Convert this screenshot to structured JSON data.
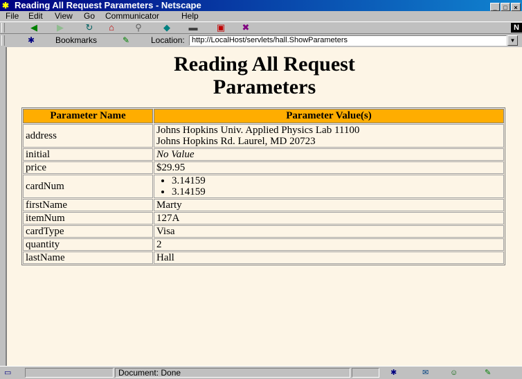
{
  "window": {
    "title": "Reading All Request Parameters - Netscape",
    "controls": [
      "_",
      "□",
      "×"
    ]
  },
  "menu": [
    "File",
    "Edit",
    "View",
    "Go",
    "Communicator",
    "Help"
  ],
  "nav": {
    "bookmarks_label": "Bookmarks",
    "location_label": "Location:",
    "url": "http://LocalHost/servlets/hall.ShowParameters"
  },
  "page": {
    "heading_line1": "Reading All Request",
    "heading_line2": "Parameters",
    "table": {
      "headers": [
        "Parameter Name",
        "Parameter Value(s)"
      ],
      "header_color": "#ffad00",
      "rows": [
        {
          "name": "address",
          "value_line1": "Johns Hopkins Univ. Applied Physics Lab 11100",
          "value_line2": "Johns Hopkins Rd. Laurel, MD 20723"
        },
        {
          "name": "initial",
          "value": "No Value"
        },
        {
          "name": "price",
          "value": "$29.95"
        },
        {
          "name": "cardNum",
          "values": [
            "3.14159",
            "3.14159"
          ]
        },
        {
          "name": "firstName",
          "value": "Marty"
        },
        {
          "name": "itemNum",
          "value": "127A"
        },
        {
          "name": "cardType",
          "value": "Visa"
        },
        {
          "name": "quantity",
          "value": "2"
        },
        {
          "name": "lastName",
          "value": "Hall"
        }
      ]
    }
  },
  "status": {
    "text": "Document: Done"
  }
}
